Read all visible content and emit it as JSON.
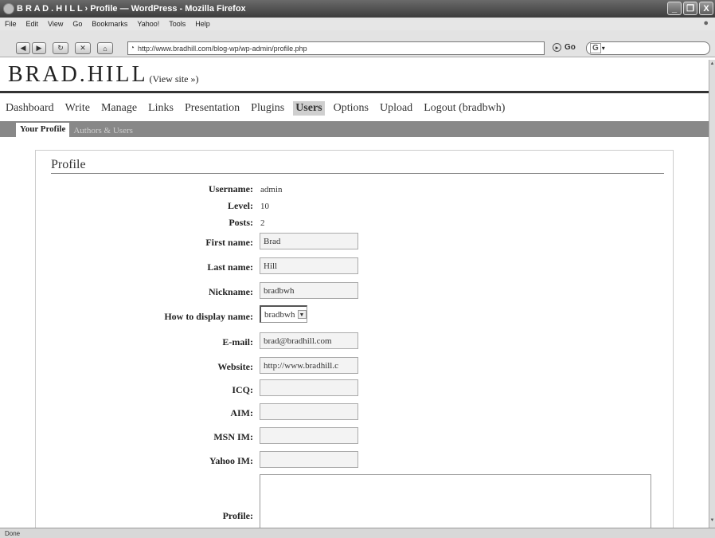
{
  "window": {
    "title": "B R A D . H I L L › Profile — WordPress - Mozilla Firefox",
    "controls": [
      "_",
      "❐",
      "X"
    ]
  },
  "menubar": [
    "File",
    "Edit",
    "View",
    "Go",
    "Bookmarks",
    "Yahoo!",
    "Tools",
    "Help"
  ],
  "toolbar": {
    "url": "http://www.bradhill.com/blog-wp/wp-admin/profile.php",
    "go_label": "Go",
    "search_engine": "G"
  },
  "site": {
    "title": "BRAD.HILL",
    "view_site": "(View site »)"
  },
  "admin_menu": [
    {
      "label": "Dashboard",
      "current": false
    },
    {
      "label": "Write",
      "current": false
    },
    {
      "label": "Manage",
      "current": false
    },
    {
      "label": "Links",
      "current": false
    },
    {
      "label": "Presentation",
      "current": false
    },
    {
      "label": "Plugins",
      "current": false
    },
    {
      "label": "Users",
      "current": true
    },
    {
      "label": "Options",
      "current": false
    },
    {
      "label": "Upload",
      "current": false
    },
    {
      "label": "Logout (bradbwh)",
      "current": false
    }
  ],
  "submenu": [
    {
      "label": "Your Profile",
      "current": true
    },
    {
      "label": "Authors & Users",
      "current": false
    }
  ],
  "profile": {
    "heading": "Profile",
    "username_label": "Username:",
    "username": "admin",
    "level_label": "Level:",
    "level": "10",
    "posts_label": "Posts:",
    "posts": "2",
    "first_name_label": "First name:",
    "first_name": "Brad",
    "last_name_label": "Last name:",
    "last_name": "Hill",
    "nickname_label": "Nickname:",
    "nickname": "bradbwh",
    "display_name_label": "How to display name:",
    "display_name": "bradbwh",
    "email_label": "E-mail:",
    "email": "brad@bradhill.com",
    "website_label": "Website:",
    "website": "http://www.bradhill.c",
    "icq_label": "ICQ:",
    "icq": "",
    "aim_label": "AIM:",
    "aim": "",
    "msn_label": "MSN IM:",
    "msn": "",
    "yahoo_label": "Yahoo IM:",
    "yahoo": "",
    "profile_label": "Profile:"
  },
  "status": "Done"
}
